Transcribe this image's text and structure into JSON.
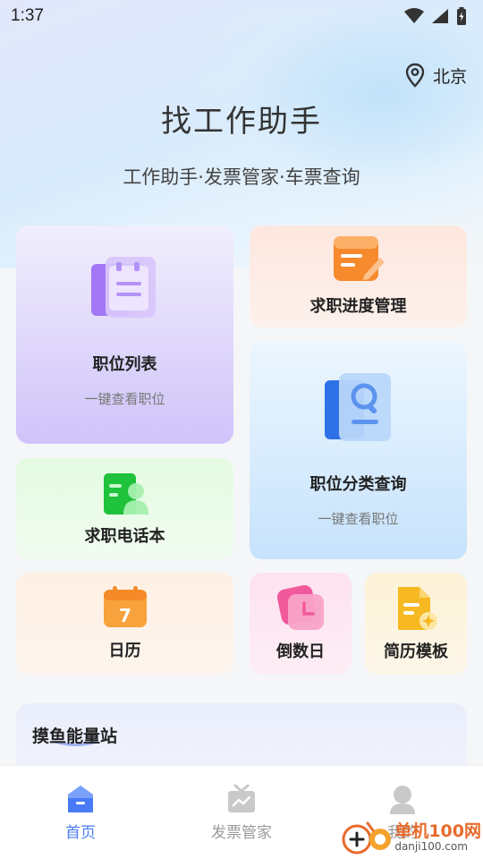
{
  "status_bar": {
    "time": "1:37"
  },
  "header": {
    "location": "北京",
    "title": "找工作助手",
    "subtitle": "工作助手·发票管家·车票查询"
  },
  "cards": {
    "job_list": {
      "title": "职位列表",
      "subtitle": "一键查看职位"
    },
    "progress": {
      "title": "求职进度管理"
    },
    "category": {
      "title": "职位分类查询",
      "subtitle": "一键查看职位"
    },
    "phonebook": {
      "title": "求职电话本"
    },
    "calendar": {
      "title": "日历",
      "icon_text": "7"
    },
    "countdown": {
      "title": "倒数日"
    },
    "resume": {
      "title": "简历模板"
    }
  },
  "energy_station": {
    "title": "摸鱼能量站"
  },
  "bottom_nav": {
    "items": [
      {
        "label": "首页",
        "icon": "home-icon",
        "active": true
      },
      {
        "label": "发票管家",
        "icon": "invoice-icon",
        "active": false
      },
      {
        "label": "我的",
        "icon": "profile-icon",
        "active": false
      }
    ]
  },
  "watermark": {
    "brand": "单机100网",
    "url": "danji100.com"
  },
  "colors": {
    "accent": "#4a7bf7",
    "inactive": "#9a9a9a"
  }
}
